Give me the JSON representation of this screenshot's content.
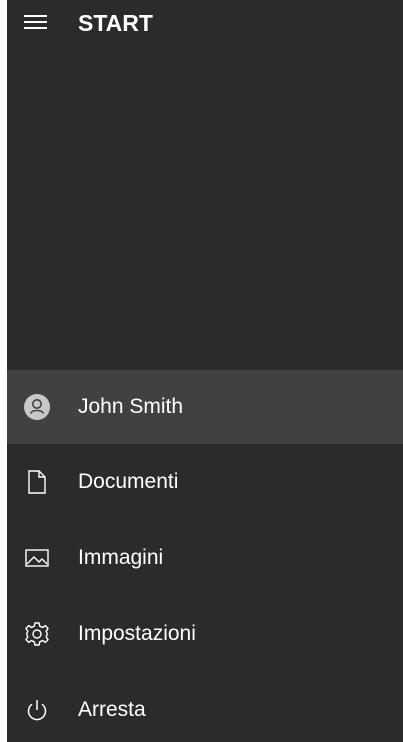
{
  "header": {
    "title": "START",
    "menu_icon": "hamburger-menu-icon"
  },
  "menu": {
    "items": [
      {
        "label": "John Smith",
        "icon": "user-avatar-icon",
        "highlighted": true
      },
      {
        "label": "Documenti",
        "icon": "document-icon"
      },
      {
        "label": "Immagini",
        "icon": "pictures-icon"
      },
      {
        "label": "Impostazioni",
        "icon": "gear-icon"
      },
      {
        "label": "Arresta",
        "icon": "power-icon"
      }
    ]
  },
  "colors": {
    "background": "#2b2b2b",
    "highlight": "#414141",
    "text": "#ffffff"
  }
}
